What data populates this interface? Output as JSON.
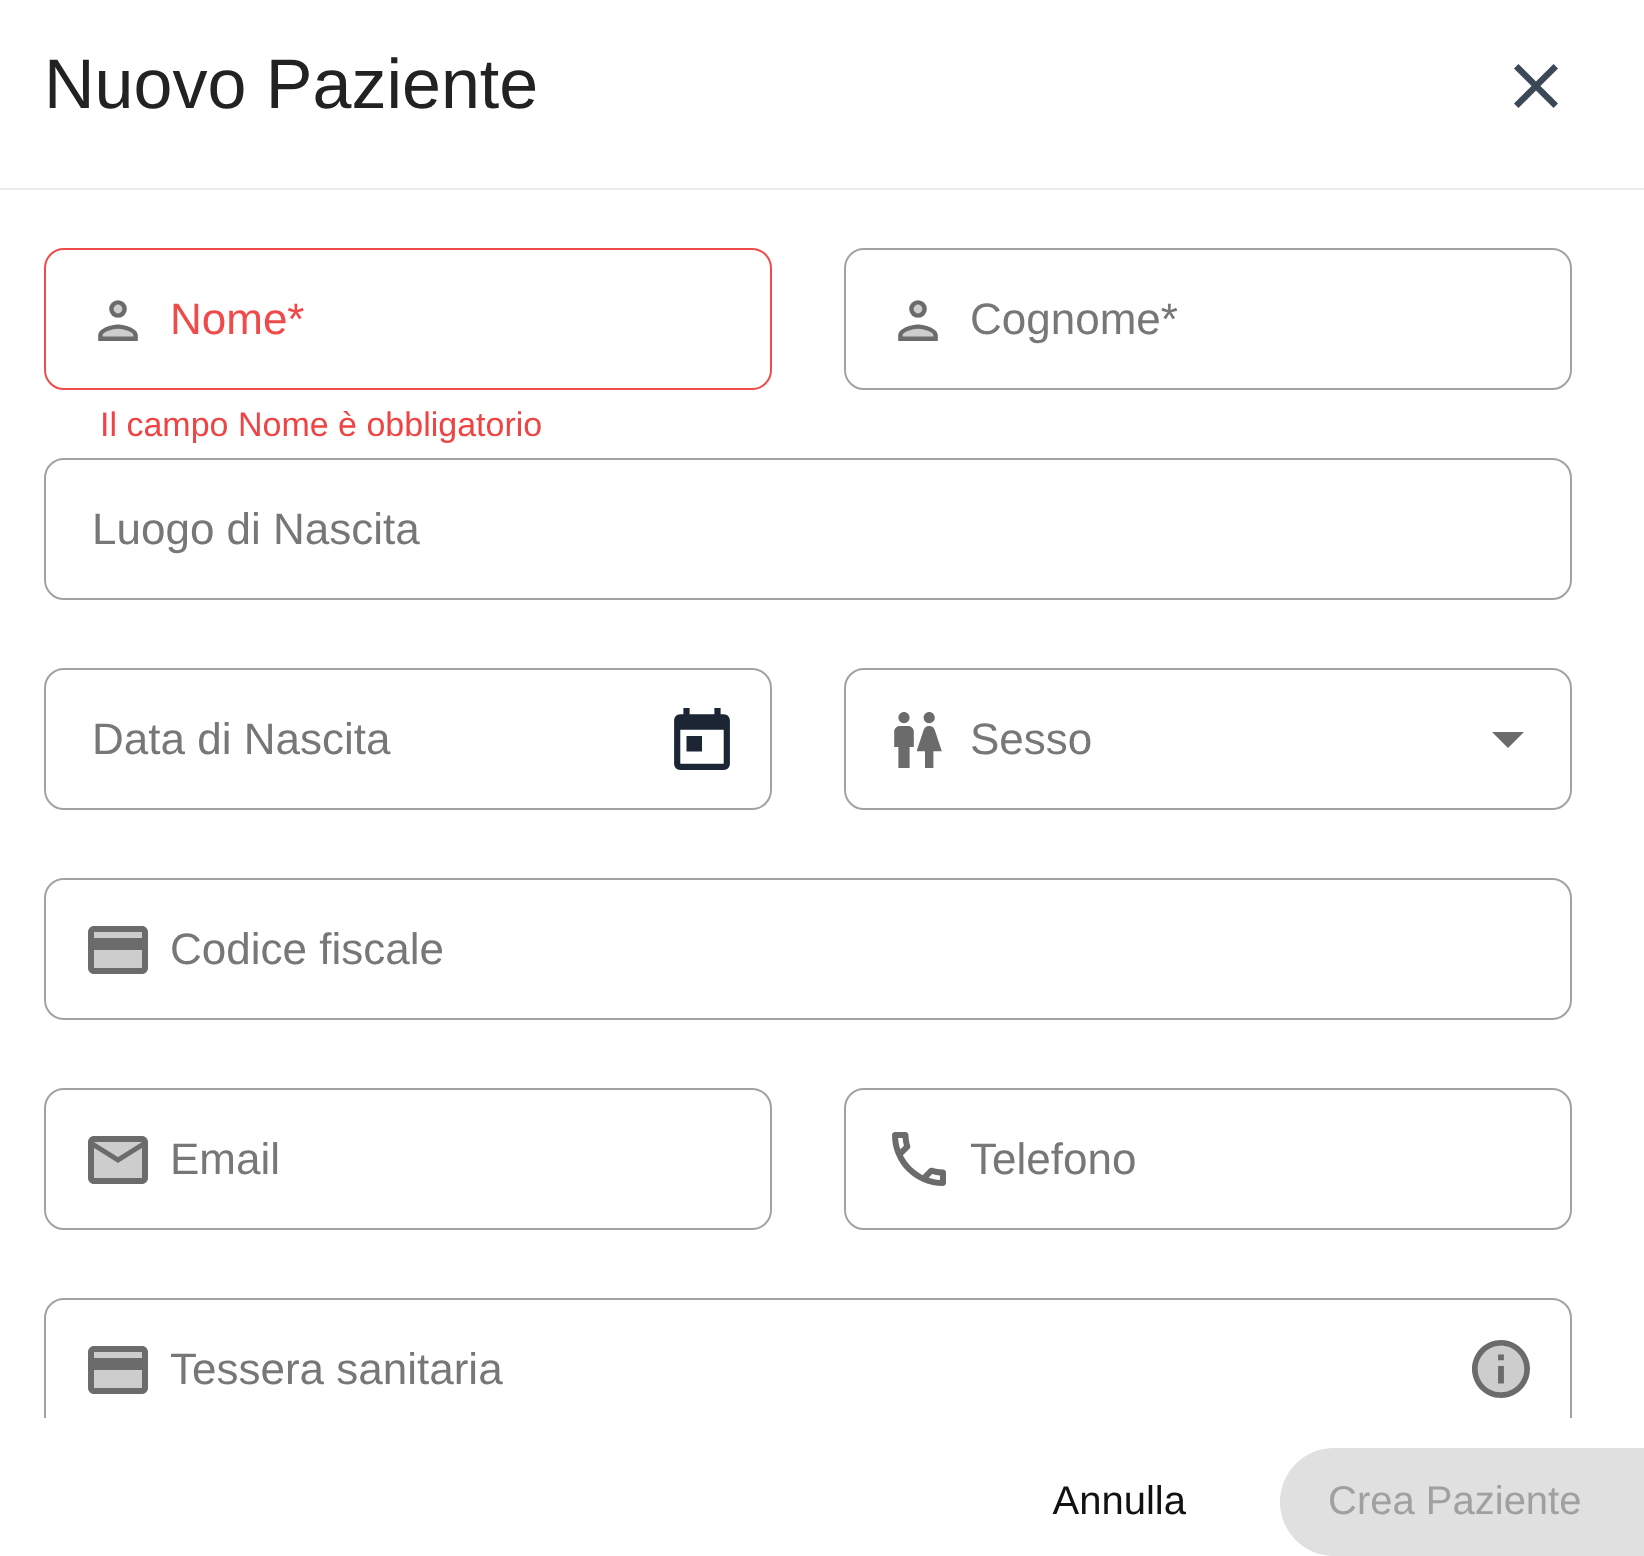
{
  "dialog": {
    "title": "Nuovo Paziente"
  },
  "form": {
    "rows": [
      {
        "fields": [
          {
            "kind": "person",
            "label": "Nome*",
            "error": true,
            "error_text": "Il campo Nome è obbligatorio"
          },
          {
            "kind": "person",
            "label": "Cognome*",
            "error": false
          }
        ]
      },
      {
        "fields": [
          {
            "kind": "plain",
            "label": "Luogo di Nascita",
            "error": false
          }
        ]
      },
      {
        "fields": [
          {
            "kind": "date",
            "label": "Data di Nascita",
            "error": false
          },
          {
            "kind": "gender",
            "label": "Sesso",
            "error": false
          }
        ]
      },
      {
        "fields": [
          {
            "kind": "card",
            "label": "Codice fiscale",
            "error": false
          }
        ]
      },
      {
        "fields": [
          {
            "kind": "email",
            "label": "Email",
            "error": false
          },
          {
            "kind": "phone",
            "label": "Telefono",
            "error": false
          }
        ]
      },
      {
        "fields": [
          {
            "kind": "healthcard",
            "label": "Tessera sanitaria",
            "error": false
          }
        ]
      }
    ]
  },
  "footer": {
    "buttons": [
      {
        "kind": "text",
        "label": "Annulla",
        "disabled": false
      },
      {
        "kind": "filled",
        "label": "Crea Paziente",
        "disabled": true
      }
    ]
  }
}
